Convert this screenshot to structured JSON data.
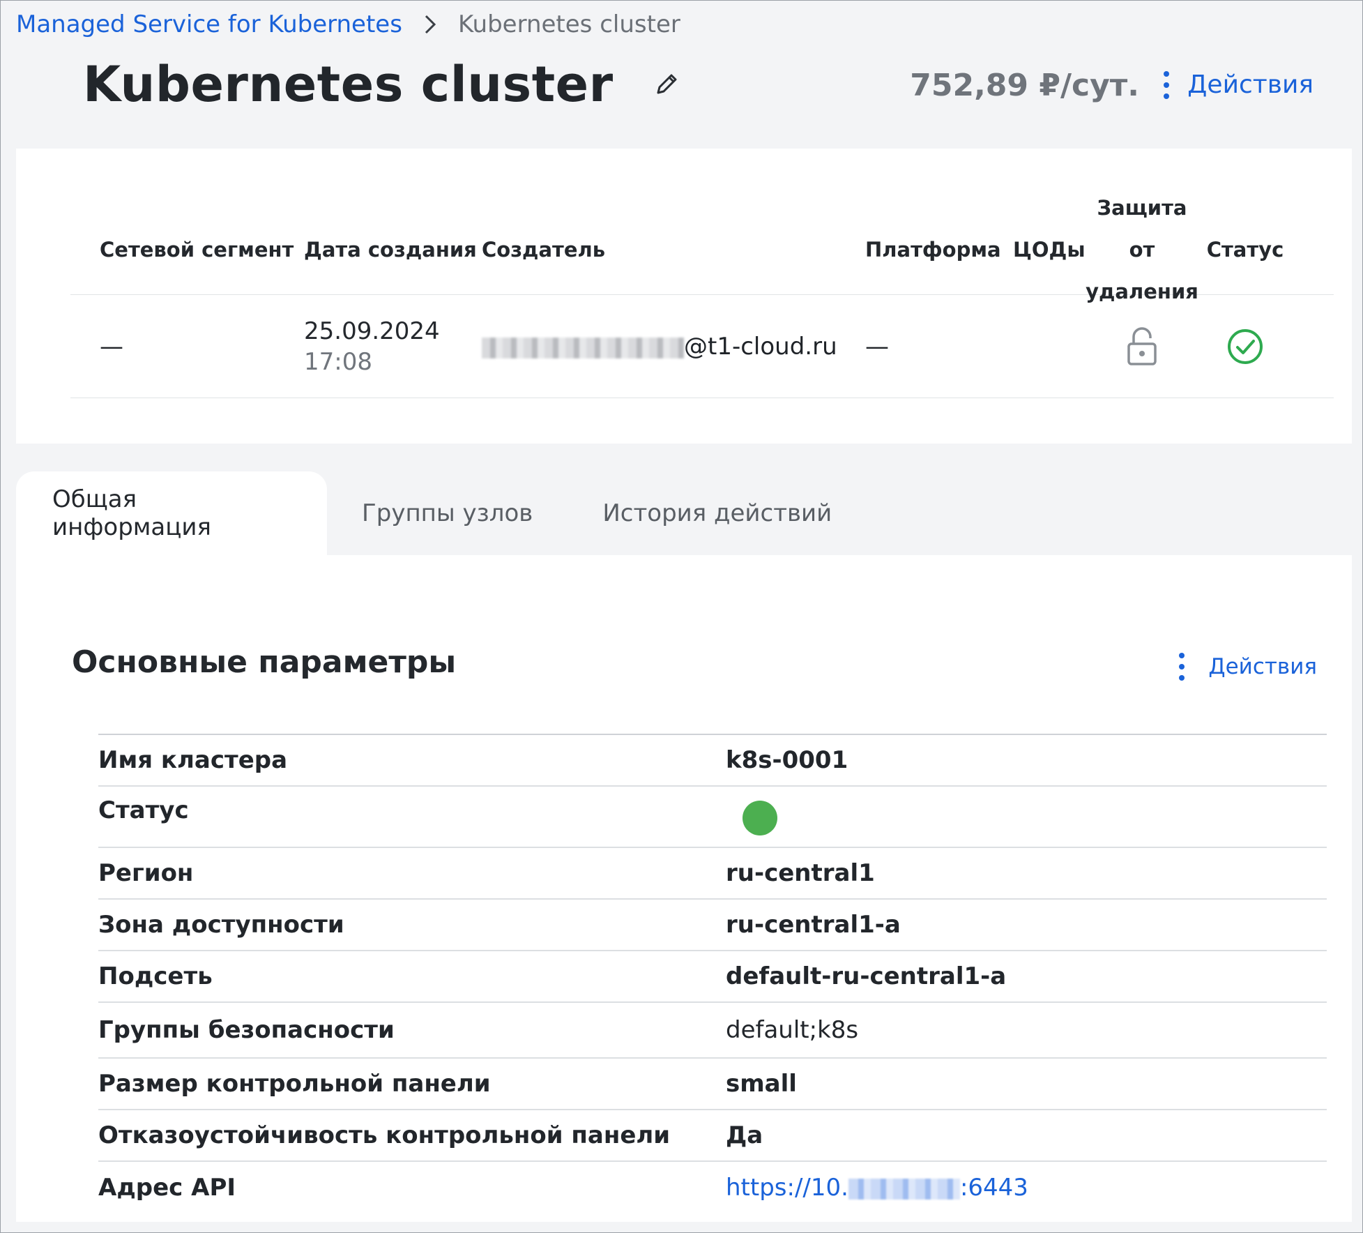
{
  "breadcrumb": {
    "parent": "Managed Service for Kubernetes",
    "current": "Kubernetes cluster",
    "separator_icon": "chevron-right-icon"
  },
  "header": {
    "title": "Kubernetes cluster",
    "price": "752,89 ₽/сут.",
    "actions_label": "Действия"
  },
  "summary": {
    "columns": [
      "Сетевой сегмент",
      "Дата создания",
      "Создатель",
      "Платформа",
      "ЦОДы",
      "Защита от удаления",
      "Статус"
    ],
    "row": {
      "segment": "—",
      "date": "25.09.2024",
      "time": "17:08",
      "creator_domain": "@t1-cloud.ru",
      "platform": "—",
      "dcs": "",
      "protection_icon": "lock-open-icon",
      "status_icon": "check-circle-icon"
    }
  },
  "tabs": [
    {
      "label": "Общая информация",
      "active": true
    },
    {
      "label": "Группы узлов",
      "active": false
    },
    {
      "label": "История действий",
      "active": false
    }
  ],
  "section": {
    "title": "Основные параметры",
    "actions_label": "Действия"
  },
  "params": [
    {
      "key": "Имя кластера",
      "value": "k8s-0001"
    },
    {
      "key": "Статус",
      "value": ""
    },
    {
      "key": "Регион",
      "value": "ru-central1"
    },
    {
      "key": "Зона доступности",
      "value": "ru-central1-a"
    },
    {
      "key": "Подсеть",
      "value": "default-ru-central1-a"
    },
    {
      "key": "Группы безопасности",
      "value": "default;k8s"
    },
    {
      "key": "Размер контрольной панели",
      "value": "small"
    },
    {
      "key": "Отказоустойчивость контрольной панели",
      "value": "Да"
    },
    {
      "key": "Адрес API",
      "value_prefix": "https://10.",
      "value_suffix": ":6443"
    }
  ],
  "colors": {
    "accent": "#1a62d9",
    "status_ok": "#4caf50",
    "check_green": "#2eaa4f"
  }
}
